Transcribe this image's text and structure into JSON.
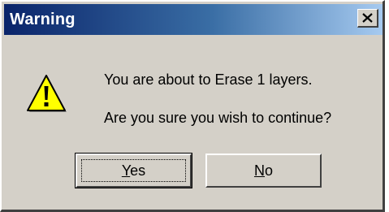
{
  "window": {
    "title": "Warning",
    "close_icon": "close-icon"
  },
  "icon": {
    "name": "warning-icon",
    "color": "#ffff00",
    "glyph": "!"
  },
  "message": {
    "line1": "You are about to Erase 1 layers.",
    "line2": "Are you sure you wish to continue?"
  },
  "buttons": {
    "yes": {
      "mnemonic": "Y",
      "rest": "es"
    },
    "no": {
      "mnemonic": "N",
      "rest": "o"
    }
  },
  "colors": {
    "title_bar_start": "#0a246a",
    "title_bar_end": "#a6caf0",
    "dialog_face": "#d4d0c8"
  }
}
